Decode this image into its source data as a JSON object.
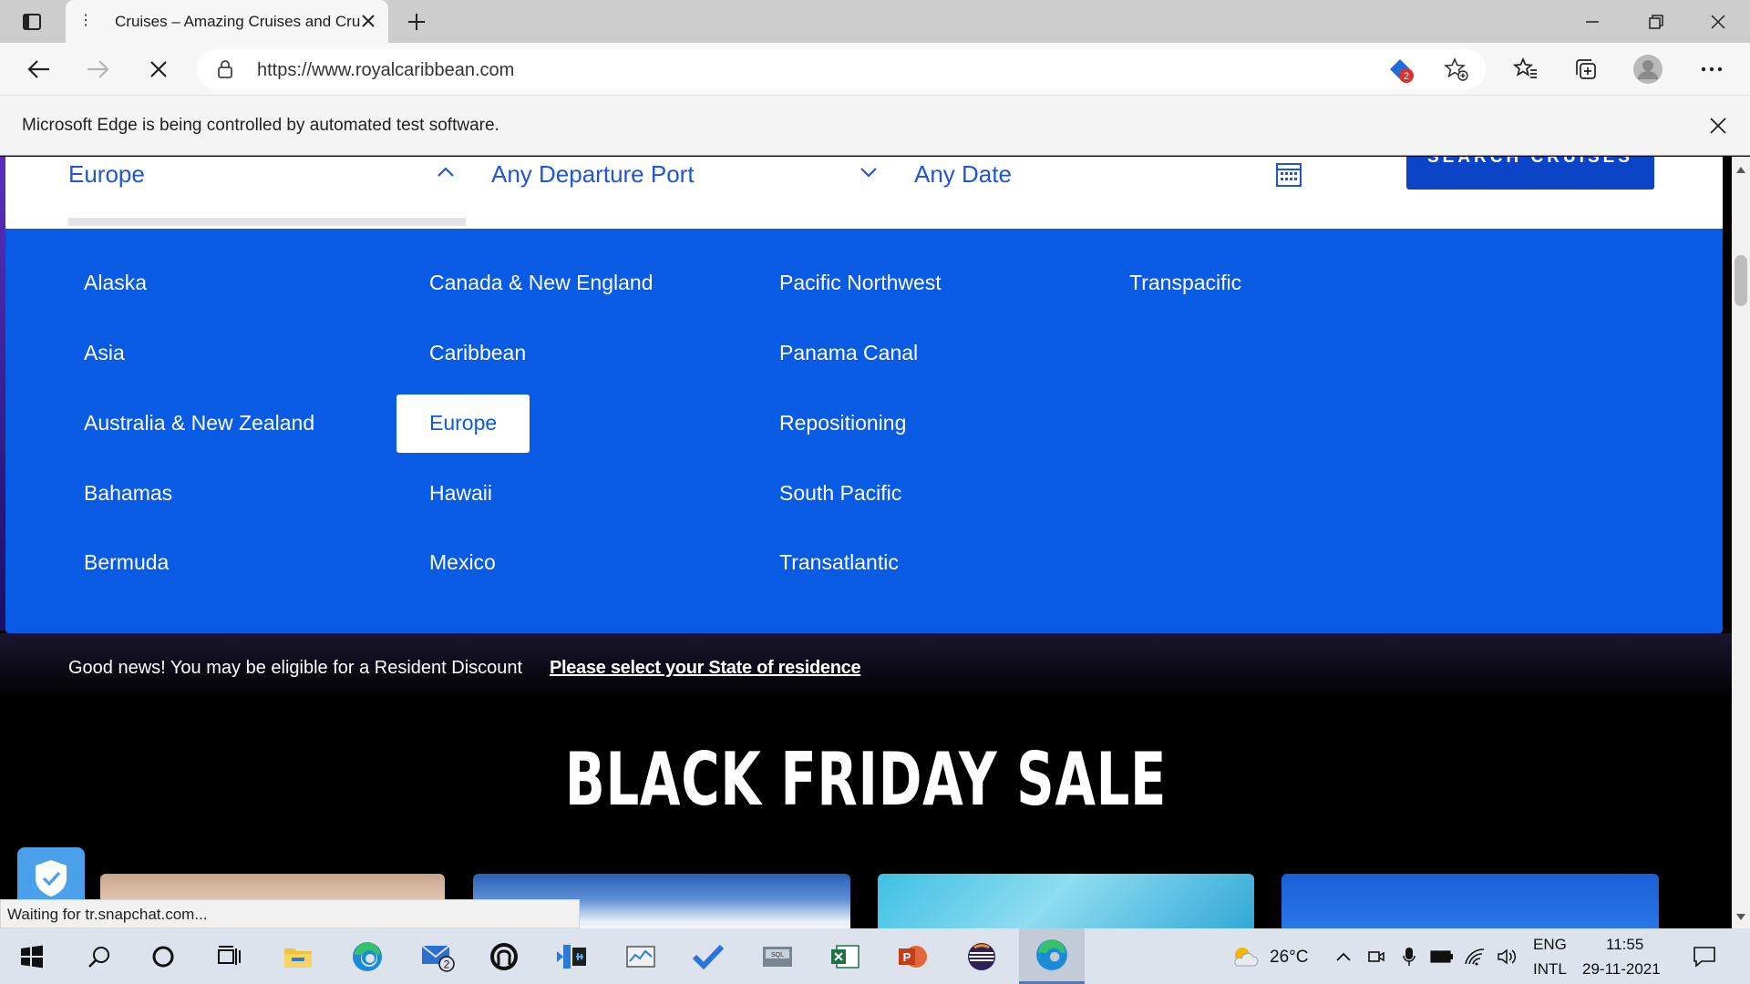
{
  "browser": {
    "tab_title": "Cruises – Amazing Cruises and Cruise",
    "url": "https://www.royalcaribbean.com",
    "extension_badge": "2",
    "infobar_text": "Microsoft Edge is being controlled by automated test software.",
    "status_text": "Waiting for tr.snapchat.com..."
  },
  "search": {
    "destination": "Europe",
    "departure": "Any Departure Port",
    "date": "Any Date",
    "button": "SEARCH CRUISES"
  },
  "destinations": {
    "col1": [
      "Alaska",
      "Asia",
      "Australia & New Zealand",
      "Bahamas",
      "Bermuda"
    ],
    "col2": [
      "Canada & New England",
      "Caribbean",
      "Europe",
      "Hawaii",
      "Mexico"
    ],
    "col3": [
      "Pacific Northwest",
      "Panama Canal",
      "Repositioning",
      "South Pacific",
      "Transatlantic"
    ],
    "col4": [
      "Transpacific"
    ],
    "selected": "Europe"
  },
  "resident": {
    "text": "Good news! You may be eligible for a Resident Discount",
    "link": "Please select your State of residence"
  },
  "headline": "BLACK FRIDAY SALE",
  "taskbar": {
    "mail_badge": "2",
    "weather": "26°C",
    "lang1": "ENG",
    "lang2": "INTL",
    "time": "11:55",
    "date": "29-11-2021"
  },
  "colors": {
    "brand_blue": "#0a5be4",
    "button_blue": "#0c44c8",
    "link_blue": "#1f55d9"
  }
}
